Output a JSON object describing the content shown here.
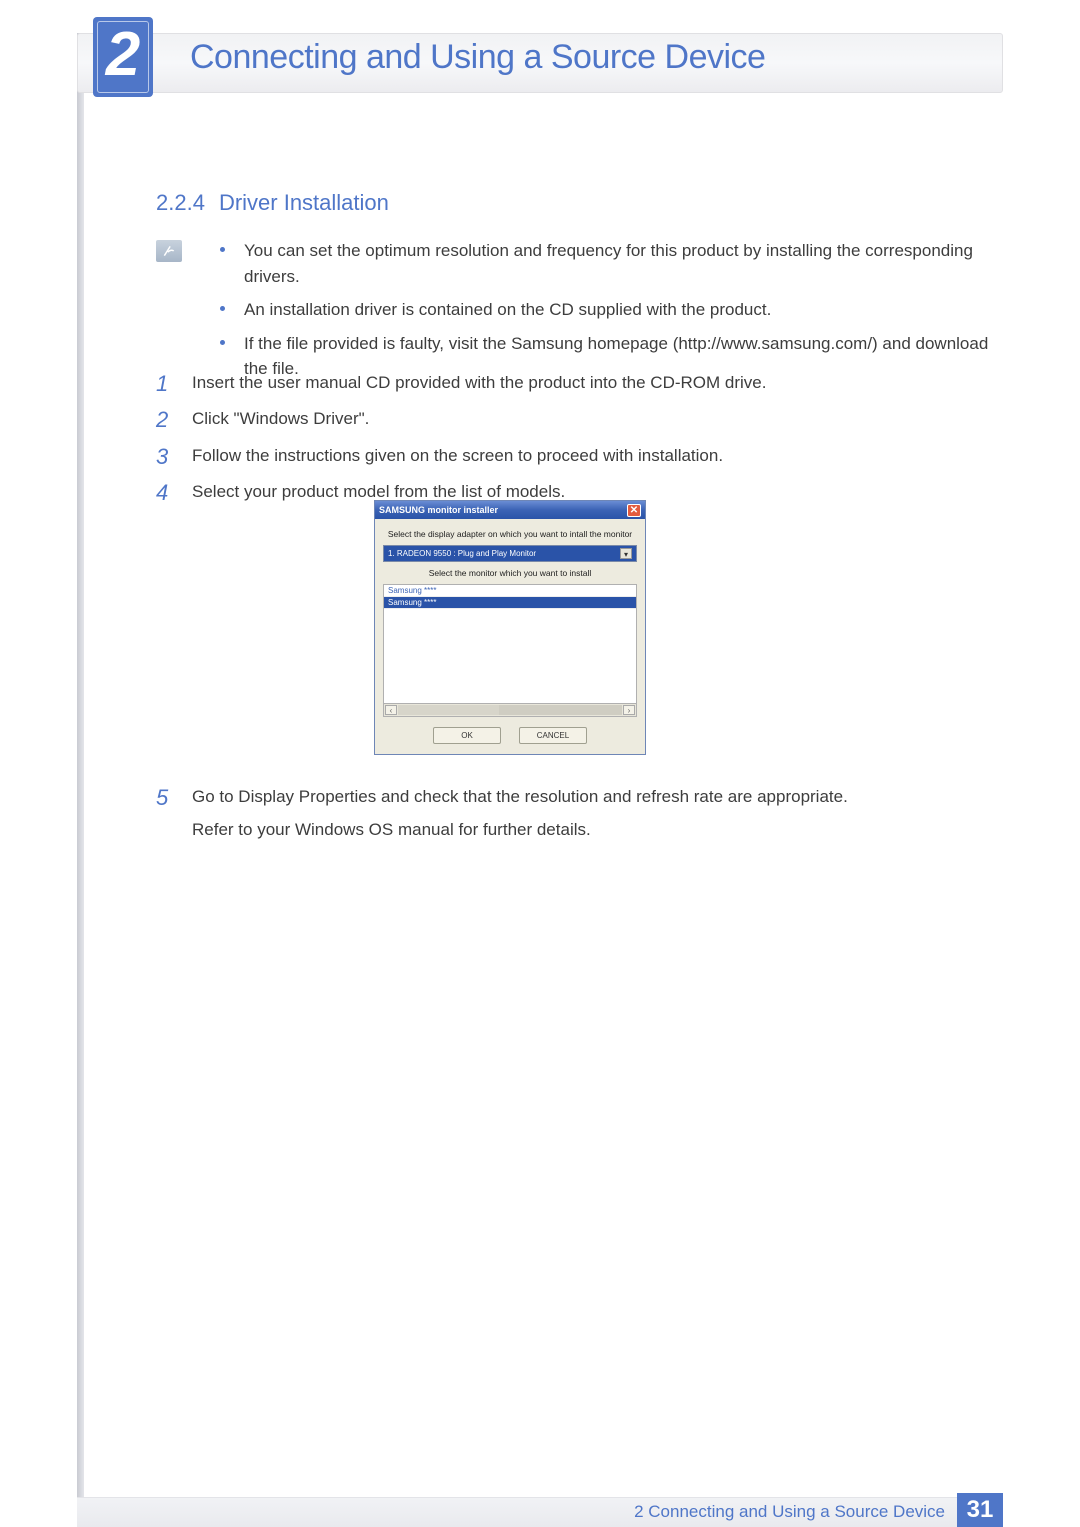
{
  "header": {
    "chapter_number": "2",
    "chapter_title": "Connecting and Using a Source Device"
  },
  "section": {
    "number": "2.2.4",
    "title": "Driver Installation"
  },
  "notes": [
    "You can set the optimum resolution and frequency for this product by installing the corresponding drivers.",
    "An installation driver is contained on the CD supplied with the product.",
    "If the file provided is faulty, visit the Samsung homepage (http://www.samsung.com/) and download the file."
  ],
  "steps": {
    "s1": {
      "num": "1",
      "text": "Insert the user manual CD provided with the product into the CD-ROM drive."
    },
    "s2": {
      "num": "2",
      "text": "Click \"Windows Driver\"."
    },
    "s3": {
      "num": "3",
      "text": "Follow the instructions given on the screen to proceed with installation."
    },
    "s4": {
      "num": "4",
      "text": "Select your product model from the list of models."
    },
    "s5": {
      "num": "5",
      "text": "Go to Display Properties and check that the resolution and refresh rate are appropriate.",
      "extra": "Refer to your Windows OS manual for further details."
    }
  },
  "installer": {
    "title": "SAMSUNG monitor installer",
    "label_adapter": "Select the display adapter on which you want to intall the monitor",
    "adapter_selected": "1. RADEON 9550 : Plug and Play Monitor",
    "label_monitor": "Select the monitor which you want to install",
    "list": [
      "Samsung ****",
      "Samsung ****"
    ],
    "ok": "OK",
    "cancel": "CANCEL"
  },
  "footer": {
    "label": "2 Connecting and Using a Source Device",
    "page": "31"
  }
}
